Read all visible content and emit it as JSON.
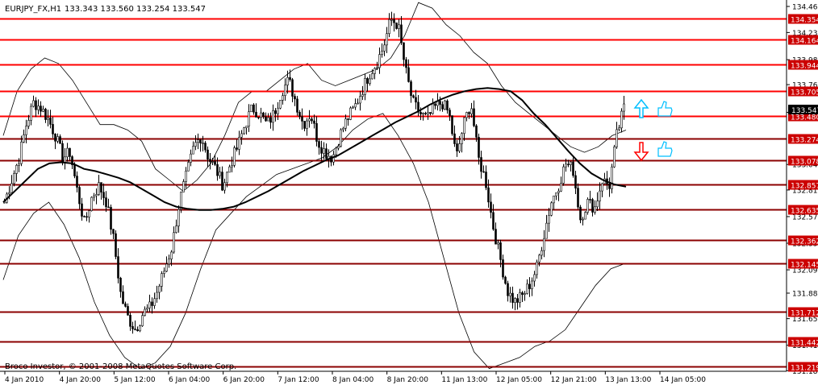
{
  "header": {
    "symbol_info": "EURJPY_FX,H1",
    "ohlc": "133.343 133.560 133.254 133.547"
  },
  "copyright": "Broco Investor, © 2001-2008 MetaQuotes Software Corp.",
  "colors": {
    "background": "#ffffff",
    "candle": "#000000",
    "level_line": "#ff0000",
    "level_line_dark": "#8b0000",
    "level_box": "#cc0000",
    "current_price_box": "#000000",
    "arrow_up": "#00bfff",
    "arrow_down": "#ff0000",
    "thumb_icon": "#00bfff"
  },
  "chart_data": {
    "type": "candlestick",
    "title": "EURJPY_FX,H1",
    "ylim": [
      131.16,
      134.54
    ],
    "grid": false,
    "price_axis_ticks": [
      "134.465",
      "134.230",
      "133.985",
      "133.760",
      "133.510",
      "133.040",
      "132.810",
      "132.570",
      "132.330",
      "132.090",
      "131.880",
      "131.650",
      "131.410",
      "131.180"
    ],
    "time_labels": [
      "4 Jan 2010",
      "4 Jan 20:00",
      "5 Jan 12:00",
      "6 Jan 04:00",
      "6 Jan 20:00",
      "7 Jan 12:00",
      "8 Jan 04:00",
      "8 Jan 20:00",
      "11 Jan 13:00",
      "12 Jan 05:00",
      "12 Jan 21:00",
      "13 Jan 13:00",
      "14 Jan 05:00"
    ],
    "levels": [
      {
        "value": "134.354",
        "style": "bright"
      },
      {
        "value": "134.164",
        "style": "bright"
      },
      {
        "value": "133.944",
        "style": "bright"
      },
      {
        "value": "133.705",
        "style": "bright"
      },
      {
        "value": "133.480",
        "style": "bright"
      },
      {
        "value": "133.274",
        "style": "dark"
      },
      {
        "value": "133.078",
        "style": "dark"
      },
      {
        "value": "132.857",
        "style": "dark"
      },
      {
        "value": "132.635",
        "style": "dark"
      },
      {
        "value": "132.362",
        "style": "dark"
      },
      {
        "value": "132.145",
        "style": "dark"
      },
      {
        "value": "131.712",
        "style": "dark"
      },
      {
        "value": "131.442",
        "style": "dark"
      },
      {
        "value": "131.219",
        "style": "dark"
      }
    ],
    "current_price": "133.547",
    "close_path": [
      132.7,
      132.9,
      133.1,
      133.4,
      133.6,
      133.55,
      133.45,
      133.3,
      133.1,
      133.15,
      132.8,
      132.5,
      132.75,
      132.85,
      132.7,
      132.35,
      131.85,
      131.65,
      131.55,
      131.7,
      131.75,
      131.9,
      132.1,
      132.3,
      132.7,
      132.95,
      133.2,
      133.3,
      133.1,
      133.0,
      132.85,
      133.05,
      133.2,
      133.4,
      133.55,
      133.5,
      133.4,
      133.5,
      133.7,
      133.8,
      133.6,
      133.4,
      133.5,
      133.25,
      133.15,
      133.1,
      133.3,
      133.45,
      133.55,
      133.7,
      133.85,
      133.95,
      134.1,
      134.35,
      134.3,
      133.9,
      133.6,
      133.5,
      133.45,
      133.55,
      133.6,
      133.5,
      133.1,
      133.4,
      133.6,
      133.1,
      132.9,
      132.5,
      132.2,
      131.9,
      131.8,
      131.85,
      131.95,
      132.1,
      132.4,
      132.7,
      132.85,
      133.05,
      133.0,
      132.55,
      132.7,
      132.65,
      132.9,
      132.85,
      133.3,
      133.55
    ],
    "ma_slow": [
      132.7,
      132.8,
      132.9,
      133.0,
      133.05,
      133.06,
      133.05,
      133.0,
      132.98,
      132.95,
      132.92,
      132.88,
      132.82,
      132.76,
      132.7,
      132.66,
      132.64,
      132.63,
      132.63,
      132.64,
      132.66,
      132.7,
      132.75,
      132.8,
      132.86,
      132.92,
      132.98,
      133.03,
      133.08,
      133.12,
      133.18,
      133.24,
      133.3,
      133.36,
      133.42,
      133.47,
      133.52,
      133.58,
      133.63,
      133.67,
      133.7,
      133.72,
      133.73,
      133.72,
      133.7,
      133.62,
      133.5,
      133.4,
      133.28,
      133.16,
      133.05,
      132.96,
      132.9,
      132.86,
      132.84
    ],
    "bb_upper": [
      133.3,
      133.7,
      133.9,
      134.0,
      133.95,
      133.8,
      133.6,
      133.4,
      133.4,
      133.35,
      133.25,
      133.0,
      132.9,
      132.8,
      132.9,
      133.05,
      133.3,
      133.6,
      133.7,
      133.7,
      133.8,
      133.9,
      133.95,
      133.8,
      133.75,
      133.8,
      133.85,
      133.9,
      134.0,
      134.2,
      134.5,
      134.45,
      134.3,
      134.2,
      134.05,
      133.95,
      133.75,
      133.6,
      133.5,
      133.4,
      133.3,
      133.2,
      133.15,
      133.2,
      133.3,
      133.35
    ],
    "bb_lower": [
      132.0,
      132.4,
      132.6,
      132.7,
      132.5,
      132.2,
      131.8,
      131.5,
      131.3,
      131.2,
      131.25,
      131.4,
      131.7,
      132.1,
      132.45,
      132.6,
      132.75,
      132.85,
      132.95,
      133.0,
      133.05,
      133.1,
      133.2,
      133.35,
      133.45,
      133.5,
      133.3,
      133.05,
      132.7,
      132.2,
      131.7,
      131.35,
      131.2,
      131.25,
      131.3,
      131.4,
      131.45,
      131.55,
      131.75,
      131.95,
      132.1,
      132.15
    ]
  }
}
